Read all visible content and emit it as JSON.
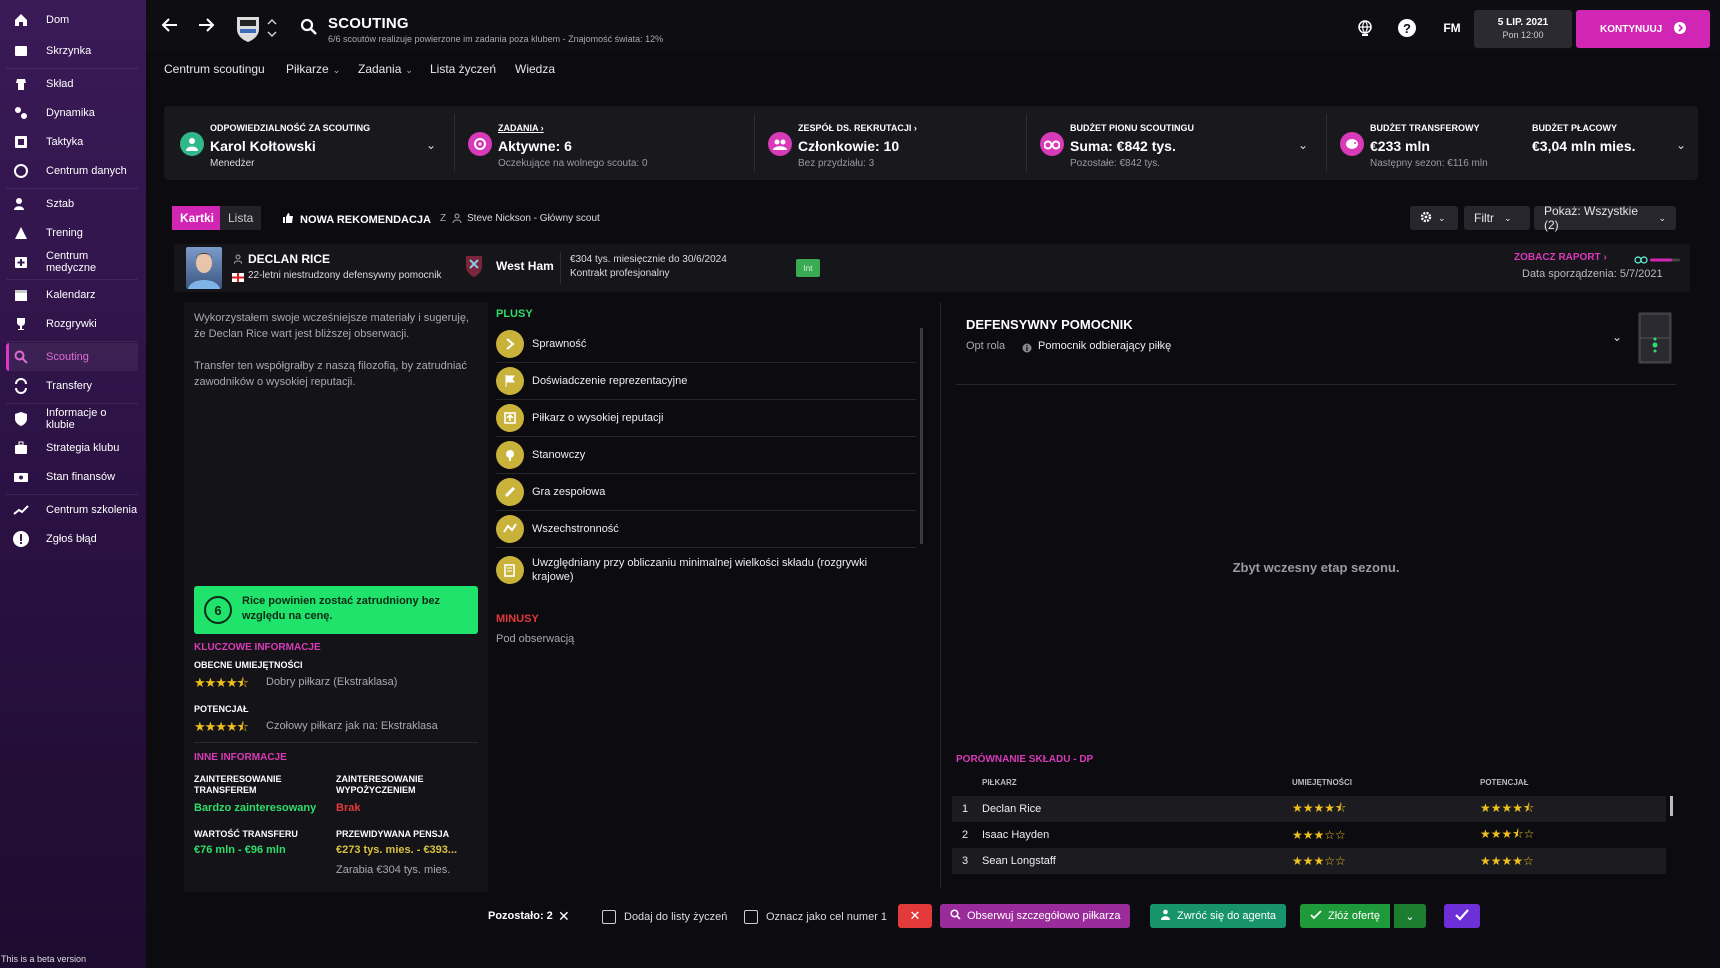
{
  "sidebar": {
    "items": [
      {
        "label": "Dom",
        "icon": "home-icon"
      },
      {
        "label": "Skrzynka",
        "icon": "inbox-icon"
      },
      {
        "label": "Skład",
        "icon": "squad-icon"
      },
      {
        "label": "Dynamika",
        "icon": "dynamics-icon"
      },
      {
        "label": "Taktyka",
        "icon": "tactics-icon"
      },
      {
        "label": "Centrum danych",
        "icon": "data-hub-icon"
      },
      {
        "label": "Sztab",
        "icon": "staff-icon"
      },
      {
        "label": "Trening",
        "icon": "training-icon"
      },
      {
        "label": "Centrum medyczne",
        "icon": "medical-icon"
      },
      {
        "label": "Kalendarz",
        "icon": "calendar-icon"
      },
      {
        "label": "Rozgrywki",
        "icon": "trophy-icon"
      },
      {
        "label": "Scouting",
        "icon": "search-icon"
      },
      {
        "label": "Transfery",
        "icon": "transfers-icon"
      },
      {
        "label": "Informacje o klubie",
        "icon": "shield-icon"
      },
      {
        "label": "Strategia klubu",
        "icon": "briefcase-icon"
      },
      {
        "label": "Stan finansów",
        "icon": "finances-icon"
      },
      {
        "label": "Centrum szkolenia",
        "icon": "development-icon"
      },
      {
        "label": "Zgłoś błąd",
        "icon": "alert-icon"
      }
    ],
    "active_index": 11,
    "beta_note": "This is a beta version"
  },
  "header": {
    "title": "SCOUTING",
    "subtitle": "6/6 scoutów realizuje powierzone im zadania poza klubem - Znajomość świata: 12%",
    "fm_label": "FM",
    "date": "5 LIP. 2021",
    "time": "Pon 12:00",
    "continue_label": "KONTYNUUJ"
  },
  "subnav": {
    "items": [
      "Centrum scoutingu",
      "Piłkarze",
      "Zadania",
      "Lista życzeń",
      "Wiedza"
    ]
  },
  "infobar": {
    "responsibility": {
      "label": "ODPOWIEDZIALNOŚĆ ZA SCOUTING",
      "value": "Karol Kołtowski",
      "sub": "Menedżer"
    },
    "tasks": {
      "label": "ZADANIA",
      "value": "Aktywne: 6",
      "sub": "Oczekujące na wolnego scouta: 0"
    },
    "team": {
      "label": "ZESPÓŁ DS. REKRUTACJI",
      "value": "Członkowie: 10",
      "sub": "Bez przydziału: 3"
    },
    "budget": {
      "label": "BUDŻET PIONU SCOUTINGU",
      "value": "Suma: €842 tys.",
      "sub": "Pozostałe: €842 tys."
    },
    "transfer": {
      "label": "BUDŻET TRANSFEROWY",
      "value": "€233 mln",
      "sub": "Następny sezon: €116 mln"
    },
    "wage": {
      "label": "BUDŻET PŁACOWY",
      "value": "€3,04 mln mies."
    }
  },
  "toolbar": {
    "tab_cards": "Kartki",
    "tab_list": "Lista",
    "new_rec": "NOWA REKOMENDACJA",
    "from_prefix": "Z",
    "scout": "Steve Nickson - Główny scout",
    "filter": "Filtr",
    "show": "Pokaż: Wszystkie (2)"
  },
  "player": {
    "name": "DECLAN RICE",
    "desc": "22-letni niestrudzony defensywny pomocnik",
    "club": "West Ham",
    "contract_line1": "€304 tys. miesięcznie do 30/6/2024",
    "contract_line2": "Kontrakt profesjonalny",
    "int_badge": "Int",
    "report_link": "ZOBACZ RAPORT",
    "report_date": "Data sporządzenia: 5/7/2021"
  },
  "left_panel": {
    "text1": "Wykorzystałem swoje wcześniejsze materiały i sugeruję, że Declan Rice wart jest bliższej obserwacji.",
    "text2": "Transfer ten współgrałby z naszą filozofią, by zatrudniać zawodników o wysokiej reputacji.",
    "rec_score": "6",
    "rec_text": "Rice powinien zostać zatrudniony bez względu na cenę.",
    "key_info": "KLUCZOWE INFORMACJE",
    "current_ability": "OBECNE UMIEJĘTNOŚCI",
    "current_stars": "★★★★⯪",
    "current_desc": "Dobry piłkarz (Ekstraklasa)",
    "potential": "POTENCJAŁ",
    "potential_stars": "★★★★⯪",
    "potential_desc": "Czołowy piłkarz jak na: Ekstraklasa",
    "other_info": "INNE INFORMACJE",
    "transfer_interest_label": "ZAINTERESOWANIE TRANSFEREM",
    "transfer_interest_value": "Bardzo zainteresowany",
    "loan_interest_label": "ZAINTERESOWANIE WYPOŻYCZENIEM",
    "loan_interest_value": "Brak",
    "transfer_value_label": "WARTOŚĆ TRANSFERU",
    "transfer_value": "€76 mln - €96 mln",
    "wage_label": "PRZEWIDYWANA PENSJA",
    "wage_value": "€273 tys. mies. - €393...",
    "earns": "Zarabia €304 tys. mies."
  },
  "mid_panel": {
    "plus_title": "PLUSY",
    "pluses": [
      "Sprawność",
      "Doświadczenie reprezentacyjne",
      "Piłkarz o wysokiej reputacji",
      "Stanowczy",
      "Gra zespołowa",
      "Wszechstronność",
      "Uwzględniany przy obliczaniu minimalnej wielkości składu (rozgrywki krajowe)"
    ],
    "minus_title": "MINUSY",
    "minus_text": "Pod obserwacją"
  },
  "right_panel": {
    "role_title": "DEFENSYWNY POMOCNIK",
    "role_sub": "Opt rola",
    "role_name": "Pomocnik odbierający piłkę",
    "too_early": "Zbyt wczesny etap sezonu.",
    "comparison_title": "PORÓWNANIE SKŁADU - DP",
    "col_player": "PIŁKARZ",
    "col_ability": "UMIEJĘTNOŚCI",
    "col_potential": "POTENCJAŁ",
    "rows": [
      {
        "num": "1",
        "name": "Declan Rice",
        "ability": "★★★★⯪",
        "potential": "★★★★⯪"
      },
      {
        "num": "2",
        "name": "Isaac Hayden",
        "ability": "★★★☆☆",
        "potential": "★★★⯪☆"
      },
      {
        "num": "3",
        "name": "Sean Longstaff",
        "ability": "★★★☆☆",
        "potential": "★★★★☆"
      }
    ]
  },
  "footer": {
    "remaining": "Pozostało: 2",
    "wishlist": "Dodaj do listy życzeń",
    "target": "Oznacz jako cel numer 1",
    "watch": "Obserwuj szczegółowo piłkarza",
    "agent": "Zwróć się do agenta",
    "offer": "Złóż ofertę"
  },
  "colors": {
    "accent": "#d126b4",
    "green": "#20e36c",
    "star": "#f0c020",
    "red": "#e23a3a"
  }
}
